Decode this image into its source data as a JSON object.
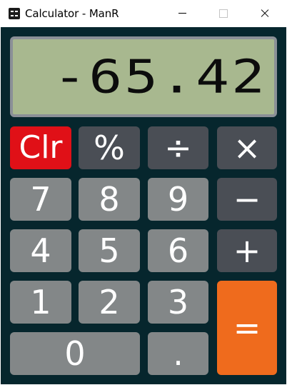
{
  "window": {
    "title": "Calculator - ManR",
    "icon": "calculator-icon",
    "controls": [
      "minimize-icon",
      "maximize-icon",
      "close-icon"
    ]
  },
  "display": {
    "value": "-65.42"
  },
  "keys": {
    "clear": "Clr",
    "percent": "%",
    "divide": "÷",
    "multiply": "×",
    "seven": "7",
    "eight": "8",
    "nine": "9",
    "minus": "−",
    "four": "4",
    "five": "5",
    "six": "6",
    "plus": "+",
    "one": "1",
    "two": "2",
    "three": "3",
    "equals": "=",
    "zero": "0",
    "decimal": "."
  },
  "colors": {
    "background": "#06262d",
    "display_bg": "#a8b88f",
    "number_key": "#838788",
    "operator_key": "#4a4e55",
    "clear_key": "#e01017",
    "equals_key": "#ef6b1d"
  }
}
